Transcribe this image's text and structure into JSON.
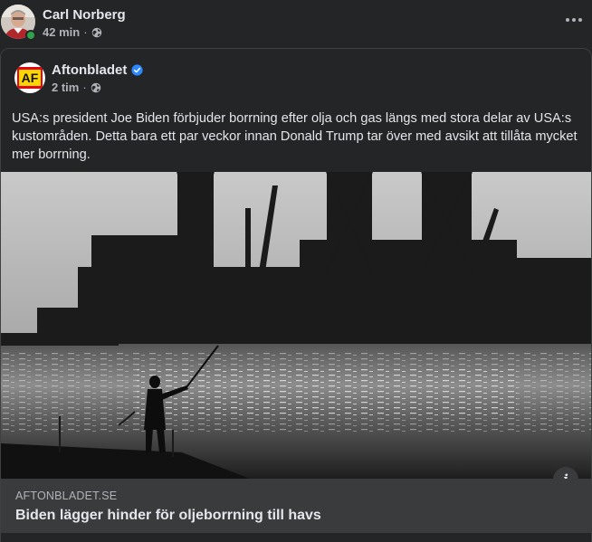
{
  "post": {
    "author": "Carl Norberg",
    "time": "42 min",
    "privacy_icon": "globe-icon",
    "more_icon": "more-options-icon",
    "online": true
  },
  "shared": {
    "page_name": "Aftonbladet",
    "verified_icon": "verified-badge-icon",
    "verified_color": "#2d88ff",
    "time": "2 tim",
    "privacy_icon": "globe-icon",
    "logo_text": "AF",
    "text": "USA:s president Joe Biden förbjuder borrning efter olja och gas längs med stora delar av USA:s kustområden. Detta bara ett par veckor innan Donald Trump tar över med avsikt att tillåta mycket mer borrning."
  },
  "link": {
    "domain": "AFTONBLADET.SE",
    "title": "Biden lägger hinder för oljeborrning till havs",
    "info_label": "i"
  },
  "colors": {
    "background": "#242526",
    "footer": "#3a3b3c",
    "text_primary": "#e4e6eb",
    "text_secondary": "#b0b3b8",
    "online": "#31a24c",
    "logo_red": "#e30613",
    "logo_yellow": "#ffd700"
  }
}
